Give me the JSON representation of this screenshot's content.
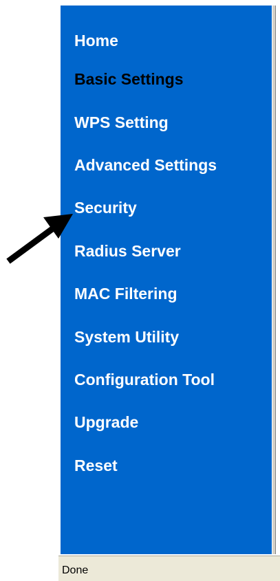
{
  "menu": {
    "items": [
      {
        "label": "Home"
      },
      {
        "label": "Basic Settings",
        "current": true
      },
      {
        "label": "WPS Setting"
      },
      {
        "label": "Advanced Settings"
      },
      {
        "label": "Security"
      },
      {
        "label": "Radius Server"
      },
      {
        "label": "MAC Filtering"
      },
      {
        "label": "System Utility"
      },
      {
        "label": "Configuration Tool"
      },
      {
        "label": "Upgrade"
      },
      {
        "label": "Reset"
      }
    ]
  },
  "status_bar": {
    "text": "Done"
  },
  "colors": {
    "menu_background": "#0066cc",
    "menu_text": "#ffffff",
    "current_item_text": "#000000",
    "pointer_arrow": "#000000"
  },
  "annotation": {
    "icon": "arrow-pointer-icon",
    "points_to": "Security"
  }
}
